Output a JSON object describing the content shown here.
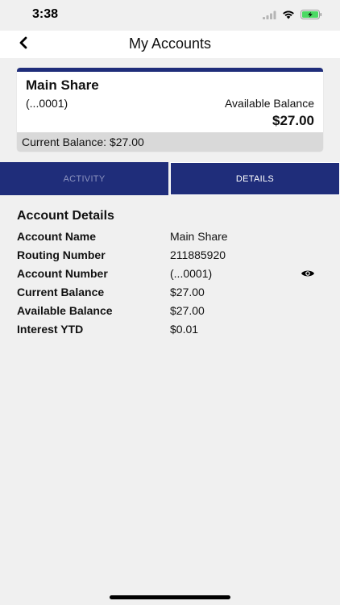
{
  "status_bar": {
    "time": "3:38"
  },
  "nav": {
    "title": "My Accounts"
  },
  "account_card": {
    "name": "Main Share",
    "number": "(...0001)",
    "available_label": "Available Balance",
    "available_value": "$27.00",
    "current_balance": "Current Balance: $27.00"
  },
  "tabs": [
    {
      "label": "ACTIVITY"
    },
    {
      "label": "DETAILS"
    }
  ],
  "details": {
    "title": "Account Details",
    "rows": [
      {
        "label": "Account Name",
        "value": "Main Share"
      },
      {
        "label": "Routing Number",
        "value": "211885920"
      },
      {
        "label": "Account Number",
        "value": "(...0001)"
      },
      {
        "label": "Current Balance",
        "value": "$27.00"
      },
      {
        "label": "Available Balance",
        "value": "$27.00"
      },
      {
        "label": "Interest YTD",
        "value": "$0.01"
      }
    ]
  },
  "colors": {
    "brand_navy": "#1f2d7a",
    "battery_green": "#4cd964"
  },
  "icons": [
    "signal-icon",
    "wifi-icon",
    "battery-charging-icon",
    "back-chevron-icon",
    "eye-icon"
  ]
}
